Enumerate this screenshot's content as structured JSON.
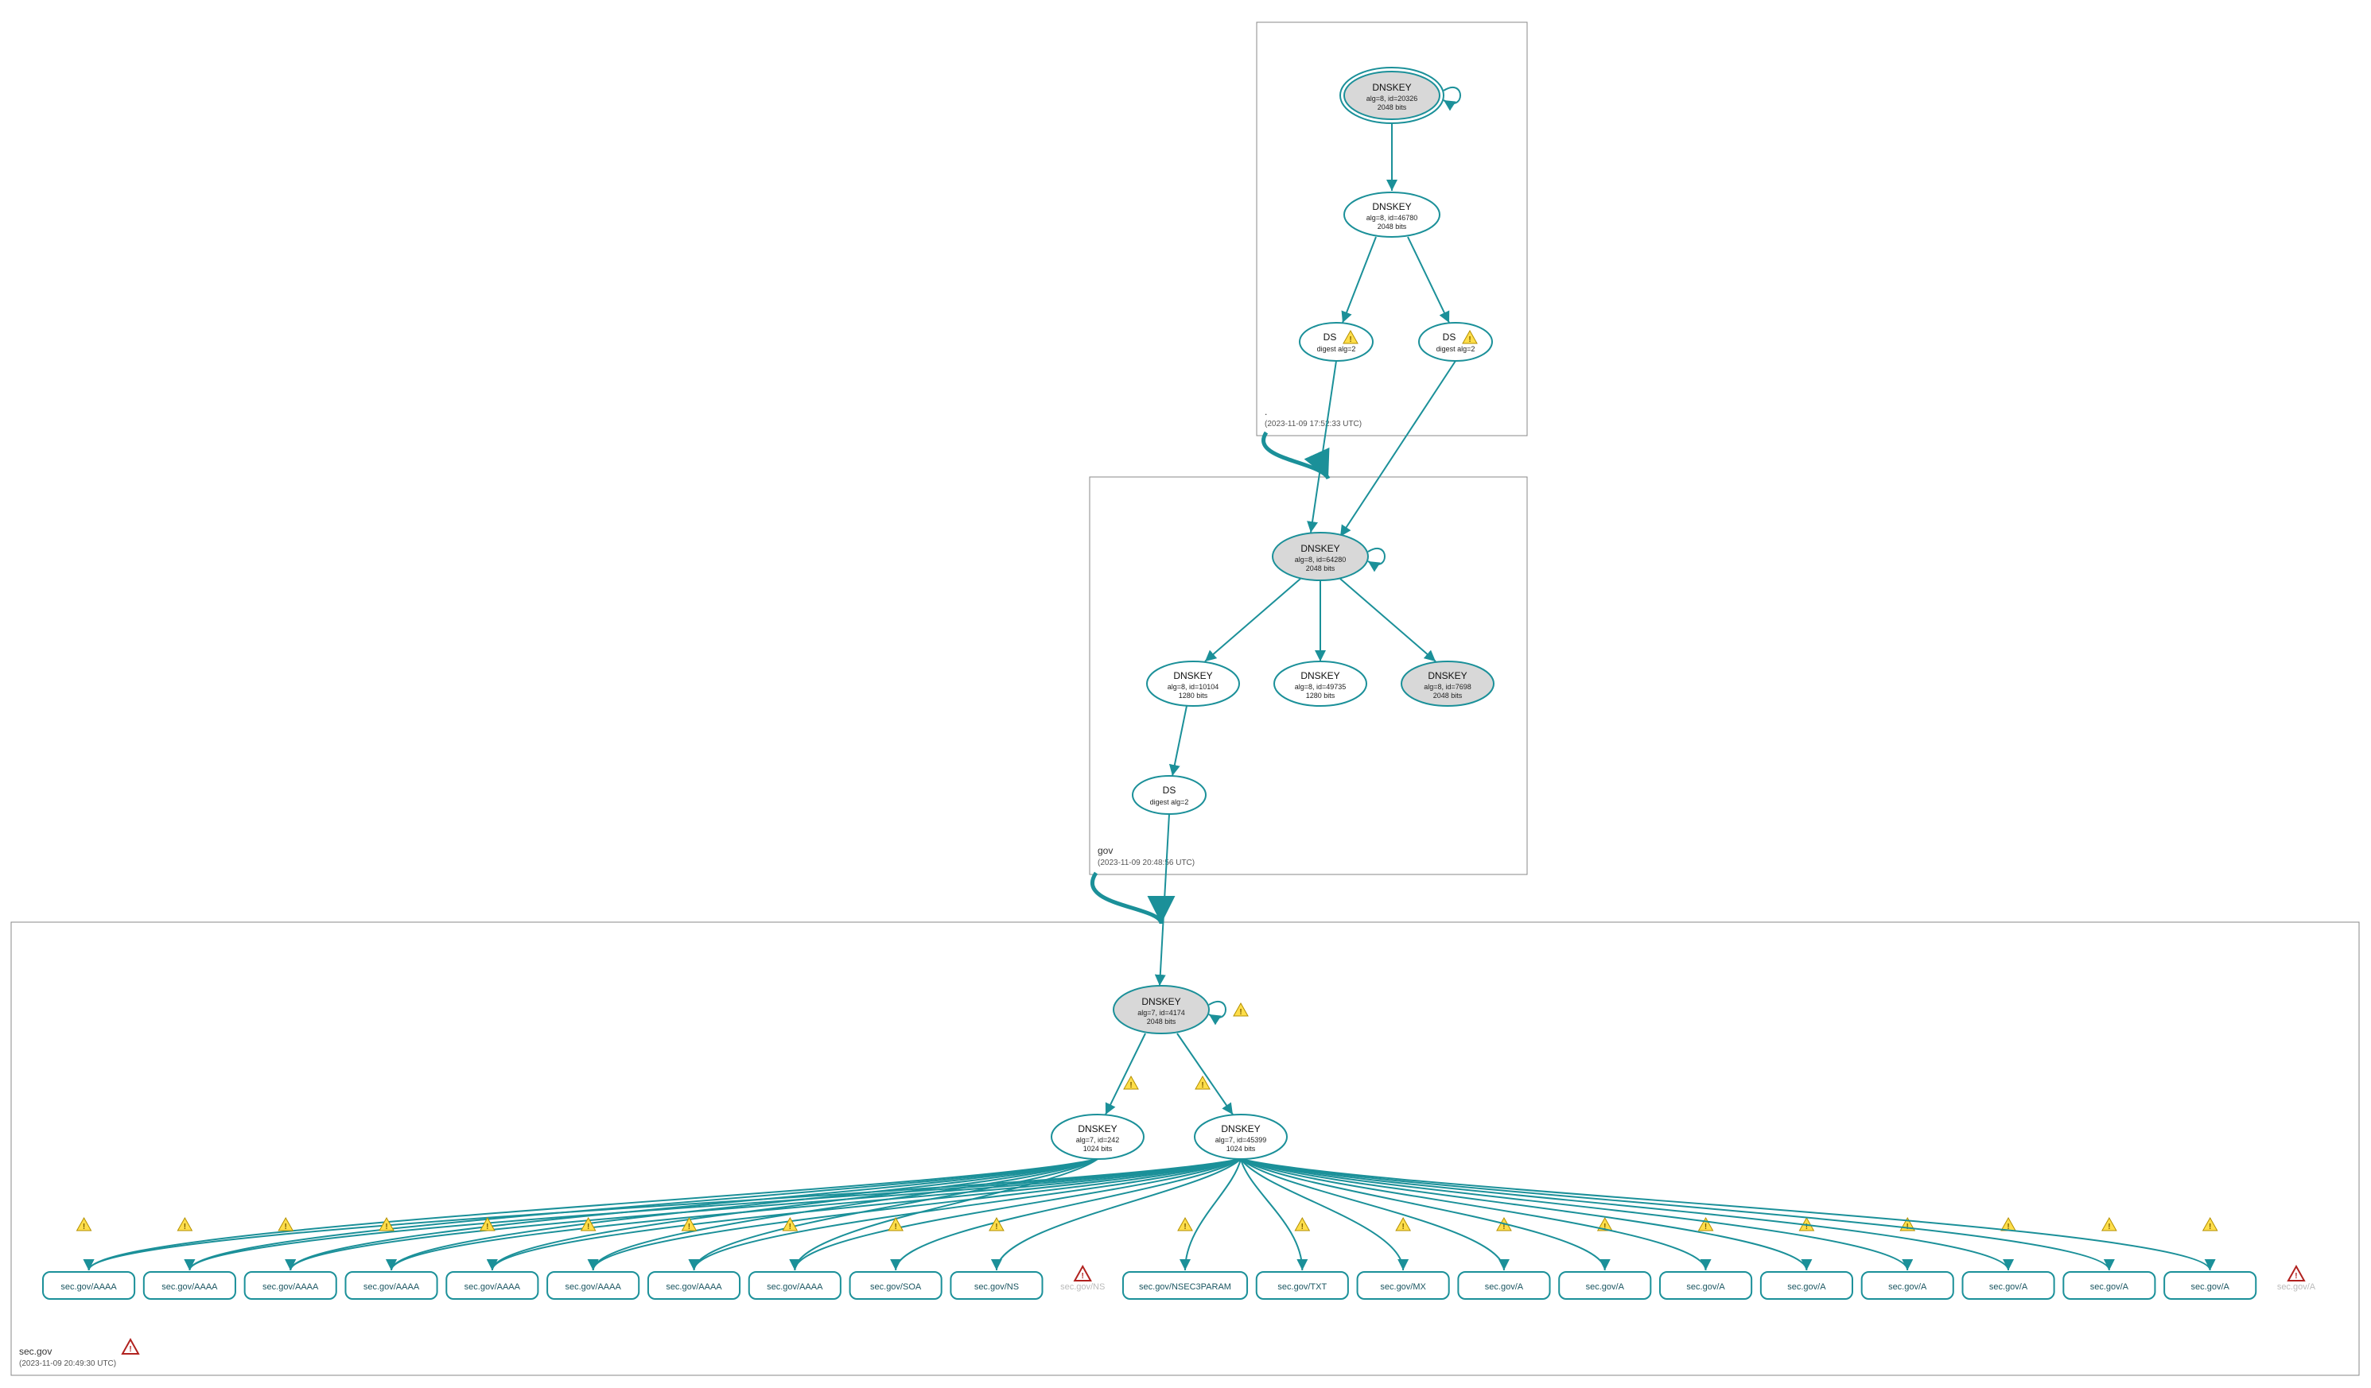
{
  "zones": {
    "root": {
      "label": ".",
      "timestamp": "(2023-11-09 17:52:33 UTC)"
    },
    "gov": {
      "label": "gov",
      "timestamp": "(2023-11-09 20:48:56 UTC)"
    },
    "sec": {
      "label": "sec.gov",
      "timestamp": "(2023-11-09 20:49:30 UTC)"
    }
  },
  "nodes": {
    "root_ksk": {
      "title": "DNSKEY",
      "line2": "alg=8, id=20326",
      "line3": "2048 bits"
    },
    "root_zsk": {
      "title": "DNSKEY",
      "line2": "alg=8, id=46780",
      "line3": "2048 bits"
    },
    "root_ds_l": {
      "title": "DS",
      "line2": "digest alg=2"
    },
    "root_ds_r": {
      "title": "DS",
      "line2": "digest alg=2"
    },
    "gov_ksk": {
      "title": "DNSKEY",
      "line2": "alg=8, id=64280",
      "line3": "2048 bits"
    },
    "gov_zsk_l": {
      "title": "DNSKEY",
      "line2": "alg=8, id=10104",
      "line3": "1280 bits"
    },
    "gov_zsk_m": {
      "title": "DNSKEY",
      "line2": "alg=8, id=49735",
      "line3": "1280 bits"
    },
    "gov_zsk_r": {
      "title": "DNSKEY",
      "line2": "alg=8, id=7698",
      "line3": "2048 bits"
    },
    "gov_ds": {
      "title": "DS",
      "line2": "digest alg=2"
    },
    "sec_ksk": {
      "title": "DNSKEY",
      "line2": "alg=7, id=4174",
      "line3": "2048 bits"
    },
    "sec_zsk_l": {
      "title": "DNSKEY",
      "line2": "alg=7, id=242",
      "line3": "1024 bits"
    },
    "sec_zsk_r": {
      "title": "DNSKEY",
      "line2": "alg=7, id=45399",
      "line3": "1024 bits"
    }
  },
  "rrsets": [
    "sec.gov/AAAA",
    "sec.gov/AAAA",
    "sec.gov/AAAA",
    "sec.gov/AAAA",
    "sec.gov/AAAA",
    "sec.gov/AAAA",
    "sec.gov/AAAA",
    "sec.gov/AAAA",
    "sec.gov/SOA",
    "sec.gov/NS",
    "sec.gov/NS",
    "sec.gov/NSEC3PARAM",
    "sec.gov/TXT",
    "sec.gov/MX",
    "sec.gov/A",
    "sec.gov/A",
    "sec.gov/A",
    "sec.gov/A",
    "sec.gov/A",
    "sec.gov/A",
    "sec.gov/A",
    "sec.gov/A",
    "sec.gov/A"
  ],
  "rrsets_faded_dnskey": [
    10
  ],
  "rrsets_faded_extra": [
    22
  ]
}
